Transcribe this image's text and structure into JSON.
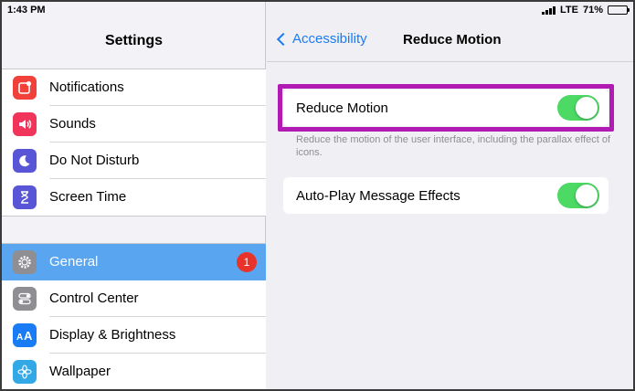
{
  "status_bar": {
    "time": "1:43 PM",
    "network": "LTE",
    "battery": "71%",
    "battery_level": 0.71
  },
  "left": {
    "title": "Settings",
    "group1": [
      {
        "label": "Notifications",
        "icon": "notifications-icon",
        "color": "#f0413b"
      },
      {
        "label": "Sounds",
        "icon": "sounds-icon",
        "color": "#f0345a"
      },
      {
        "label": "Do Not Disturb",
        "icon": "moon-icon",
        "color": "#5856d6"
      },
      {
        "label": "Screen Time",
        "icon": "hourglass-icon",
        "color": "#5856d6"
      }
    ],
    "group2": [
      {
        "label": "General",
        "icon": "gear-icon",
        "color": "#8e8e93",
        "selected": true,
        "badge": "1"
      },
      {
        "label": "Control Center",
        "icon": "control-center-icon",
        "color": "#8e8e93"
      },
      {
        "label": "Display & Brightness",
        "icon": "display-icon",
        "color": "#1a7cf5"
      },
      {
        "label": "Wallpaper",
        "icon": "wallpaper-icon",
        "color": "#33a8e6"
      }
    ]
  },
  "right": {
    "back_label": "Accessibility",
    "title": "Reduce Motion",
    "settings": [
      {
        "label": "Reduce Motion",
        "on": true
      },
      {
        "label": "Auto-Play Message Effects",
        "on": true
      }
    ],
    "description": "Reduce the motion of the user interface, including the parallax effect of icons."
  },
  "colors": {
    "accent": "#1a7cf5",
    "toggle_on": "#4cd964",
    "highlight": "#b21ab4",
    "selected_row": "#5aa5f0",
    "badge": "#e8332b"
  }
}
